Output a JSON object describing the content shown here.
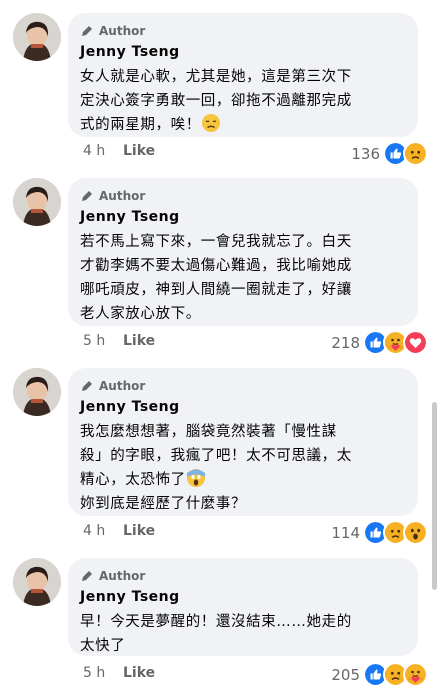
{
  "author_badge": "Author",
  "comments": [
    {
      "name": "Jenny Tseng",
      "text_lines": [
        "女人就是心軟，尤其是她，這是第三次下",
        "定決心簽字勇敢一回，卻拖不過離那完成",
        "式的兩星期，唉！"
      ],
      "time": "4 h",
      "like": "Like",
      "count": "136",
      "reactions": [
        "like-reaction-icon",
        "sad-reaction-icon"
      ]
    },
    {
      "name": "Jenny Tseng",
      "text_lines": [
        "若不馬上寫下來，一會兒我就忘了。白天",
        "才勸李媽不要太過傷心難過，我比喻她成",
        "哪吒頑皮，神到人間繞一圈就走了，好讓",
        "老人家放心放下。"
      ],
      "time": "5 h",
      "like": "Like",
      "count": "218",
      "reactions": [
        "like-reaction-icon",
        "care-reaction-icon",
        "love-reaction-icon"
      ]
    },
    {
      "name": "Jenny Tseng",
      "text_lines": [
        "我怎麼想想著，腦袋竟然裝著「慢性謀",
        "殺」的字眼，我瘋了吧！太不可思議，太",
        "精心，太恐怖了",
        "妳到底是經歷了什麼事？"
      ],
      "time": "4 h",
      "like": "Like",
      "count": "114",
      "reactions": [
        "like-reaction-icon",
        "sad-reaction-icon",
        "wow-reaction-icon"
      ]
    },
    {
      "name": "Jenny Tseng",
      "text_lines": [
        "早！今天是夢醒的！還沒結束……她走的",
        "太快了"
      ],
      "time": "5 h",
      "like": "Like",
      "count": "205",
      "reactions": [
        "like-reaction-icon",
        "sad-reaction-icon",
        "care-reaction-icon"
      ]
    }
  ],
  "colors": {
    "like_blue": "#1877f2",
    "love_red": "#f33e58",
    "reaction_yellow": "#f7b125",
    "bubble_bg": "#f0f2f5"
  }
}
